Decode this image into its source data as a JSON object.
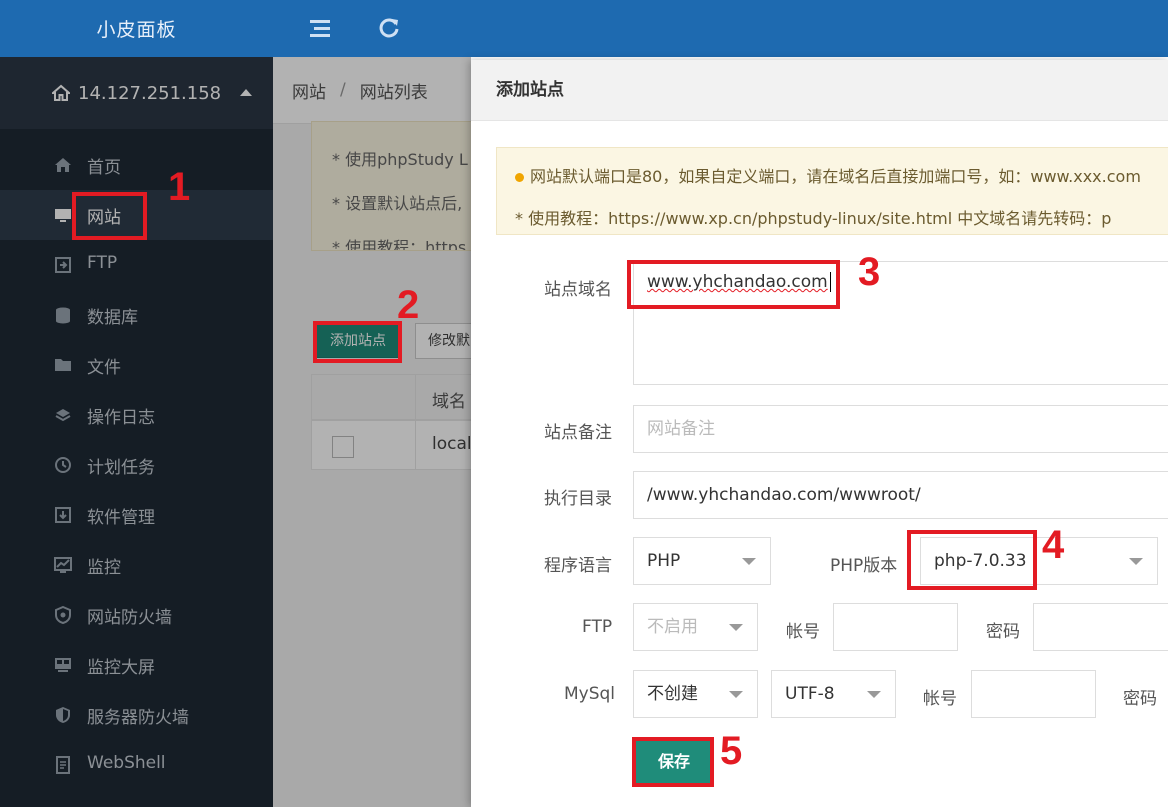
{
  "app": {
    "title": "小皮面板"
  },
  "server": {
    "ip": "14.127.251.158"
  },
  "sidebar": {
    "items": [
      {
        "label": "首页",
        "icon": "home-icon"
      },
      {
        "label": "网站",
        "icon": "monitor-icon"
      },
      {
        "label": "FTP",
        "icon": "ftp-icon"
      },
      {
        "label": "数据库",
        "icon": "database-icon"
      },
      {
        "label": "文件",
        "icon": "folder-icon"
      },
      {
        "label": "操作日志",
        "icon": "layers-icon"
      },
      {
        "label": "计划任务",
        "icon": "clock-icon"
      },
      {
        "label": "软件管理",
        "icon": "download-icon"
      },
      {
        "label": "监控",
        "icon": "chart-icon"
      },
      {
        "label": "网站防火墙",
        "icon": "shield-icon"
      },
      {
        "label": "监控大屏",
        "icon": "screen-icon"
      },
      {
        "label": "服务器防火墙",
        "icon": "shield-fill-icon"
      },
      {
        "label": "WebShell",
        "icon": "terminal-icon"
      }
    ],
    "active_index": 1
  },
  "breadcrumb": {
    "root": "网站",
    "sep": "/",
    "current": "网站列表"
  },
  "page": {
    "notice_lines": [
      "* 使用phpStudy L",
      "* 设置默认站点后,",
      "* 使用教程：https"
    ],
    "add_site_button": "添加站点",
    "modify_default_button": "修改默",
    "table": {
      "header_domain": "域名",
      "row_domain": "local"
    }
  },
  "modal": {
    "title": "添加站点",
    "notice_line1": "网站默认端口是80，如果自定义端口，请在域名后直接加端口号，如：www.xxx.com",
    "notice_line2": "* 使用教程：https://www.xp.cn/phpstudy-linux/site.html    中文域名请先转码：p",
    "domain_label": "站点域名",
    "domain_value": "www.yhchandao.com",
    "remark_label": "站点备注",
    "remark_placeholder": "网站备注",
    "dir_label": "执行目录",
    "dir_value": "/www.yhchandao.com/wwwroot/",
    "lang_label": "程序语言",
    "lang_value": "PHP",
    "php_version_label": "PHP版本",
    "php_version_value": "php-7.0.33",
    "ftp_label": "FTP",
    "ftp_value": "不启用",
    "ftp_account_label": "帐号",
    "ftp_password_label": "密码",
    "mysql_label": "MySql",
    "mysql_value": "不创建",
    "charset_value": "UTF-8",
    "mysql_account_label": "帐号",
    "mysql_password_label": "密码",
    "save_button": "保存"
  },
  "annotations": [
    "1",
    "2",
    "3",
    "4",
    "5"
  ],
  "colors": {
    "header": "#1e6ab0",
    "sidebar": "#1f2a36",
    "accent": "#1f8c7a",
    "annotation": "#e31b23"
  }
}
